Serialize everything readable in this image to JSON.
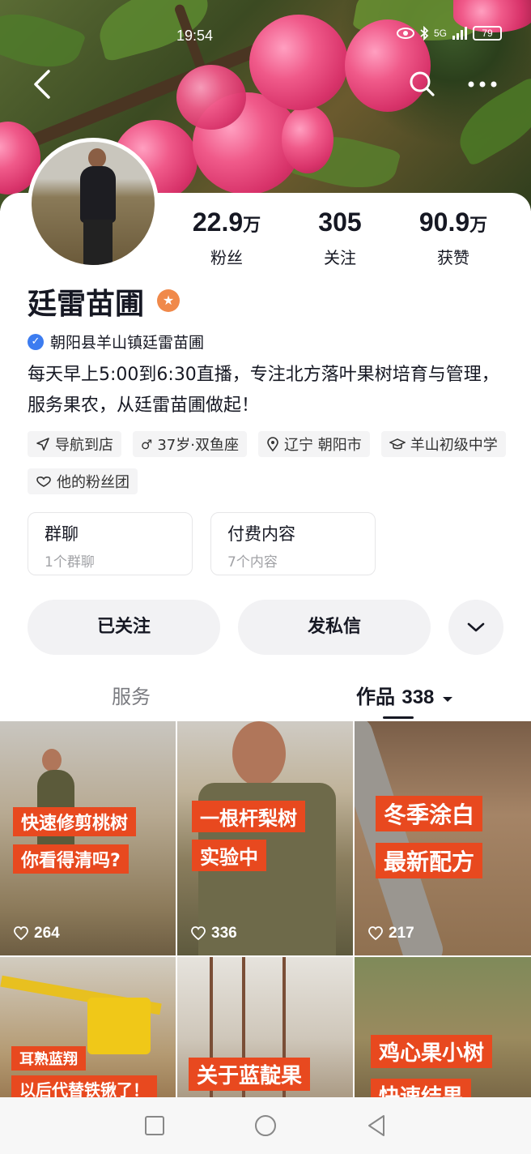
{
  "status_bar": {
    "time": "19:54",
    "signal": "5G",
    "battery": "79"
  },
  "profile": {
    "name": "廷雷苗圃",
    "verified_label": "朝阳县羊山镇廷雷苗圃",
    "bio": "每天早上5:00到6:30直播，专注北方落叶果树培育与管理，服务果农，从廷雷苗圃做起！",
    "stats": [
      {
        "value": "22.9",
        "unit": "万",
        "label": "粉丝"
      },
      {
        "value": "305",
        "unit": "",
        "label": "关注"
      },
      {
        "value": "90.9",
        "unit": "万",
        "label": "获赞"
      }
    ],
    "tags": [
      {
        "icon": "navigation-icon",
        "text": "导航到店"
      },
      {
        "icon": "male-icon",
        "text": "37岁·双鱼座"
      },
      {
        "icon": "location-icon",
        "text": "辽宁 朝阳市"
      },
      {
        "icon": "school-icon",
        "text": "羊山初级中学"
      },
      {
        "icon": "fan-group-icon",
        "text": "他的粉丝团"
      }
    ],
    "boxes": [
      {
        "title": "群聊",
        "sub": "1个群聊"
      },
      {
        "title": "付费内容",
        "sub": "7个内容"
      }
    ],
    "actions": {
      "follow": "已关注",
      "message": "发私信"
    }
  },
  "tabs": {
    "service": "服务",
    "works": "作品",
    "works_count": "338"
  },
  "videos": [
    {
      "captions": [
        "快速修剪桃树",
        "你看得清吗?"
      ],
      "likes": "264"
    },
    {
      "captions": [
        "一根杆梨树",
        "实验中"
      ],
      "likes": "336"
    },
    {
      "captions": [
        "冬季涂白",
        "最新配方"
      ],
      "likes": "217"
    },
    {
      "captions": [
        "耳熟蓝翔",
        "以后代替铁锹了！"
      ],
      "likes": ""
    },
    {
      "captions": [
        "关于蓝靛果"
      ],
      "likes": ""
    },
    {
      "captions": [
        "鸡心果小树",
        "快速结果"
      ],
      "likes": ""
    }
  ],
  "colors": {
    "accent": "#e8491f",
    "badge": "#f0894a",
    "verify": "#3c7cf0"
  }
}
